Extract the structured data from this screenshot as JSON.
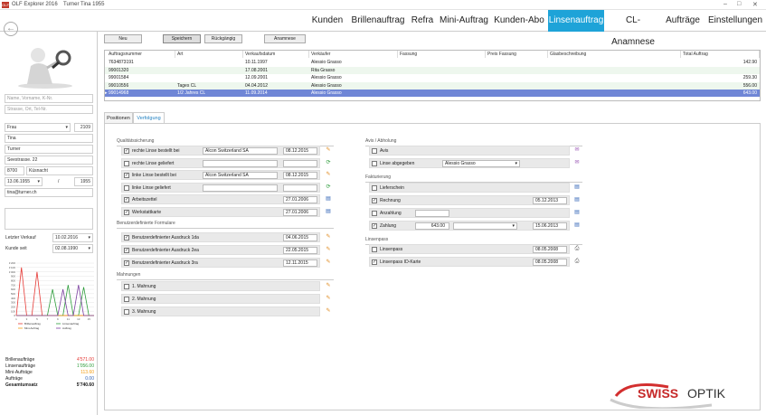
{
  "titlebar": {
    "app": "OLF Explorer 2016",
    "customer": "Turner  Tina  1955"
  },
  "nav": {
    "tabs": [
      "Kunden",
      "Brillenauftrag",
      "Refra",
      "Mini-Auftrag",
      "Kunden-Abo",
      "Linsenauftrag",
      "CL-Anamnese",
      "Aufträge",
      "Einstellungen"
    ]
  },
  "customer": {
    "search_name": "Name, Vorname, K-Nr.",
    "search_address": "Strasse, Ort, Tel-Nr.",
    "salutation": "Frau",
    "number": "2109",
    "firstname": "Tina",
    "lastname": "Turner",
    "street": "Seestrasse. 22",
    "zip": "8700",
    "city": "Küsnacht",
    "dob": "13.06.1955",
    "age_sep": "/",
    "year": "1955",
    "email": "tina@turner.ch",
    "last_sale_label": "Letzter Verkauf",
    "last_sale": "10.02.2016",
    "customer_since_label": "Kunde seit",
    "customer_since": "02.08.1990"
  },
  "chart_data": {
    "type": "line",
    "x": [
      1,
      2,
      3,
      4,
      5,
      6,
      7,
      8,
      9,
      10,
      11,
      12,
      13,
      14,
      15,
      16
    ],
    "xticks": [
      "1",
      "3",
      "5",
      "7",
      "9",
      "11",
      "13",
      "15"
    ],
    "yticks": [
      "1'200",
      "1'100",
      "1'000",
      "900",
      "800",
      "700",
      "600",
      "500",
      "400",
      "300",
      "200",
      "100",
      "0"
    ],
    "ylim": [
      0,
      1200
    ],
    "series": [
      {
        "name": "Brillenauftrag",
        "color": "#e53935",
        "values": [
          0,
          1100,
          0,
          0,
          1000,
          0,
          0,
          0,
          0,
          0,
          0,
          0,
          0,
          0,
          0,
          0
        ]
      },
      {
        "name": "Linsenauftrag",
        "color": "#2e9d3c",
        "values": [
          0,
          0,
          0,
          0,
          0,
          0,
          0,
          600,
          0,
          0,
          700,
          0,
          0,
          650,
          0,
          0
        ]
      },
      {
        "name": "Mini-Auftrag",
        "color": "#f39c12",
        "values": [
          0,
          0,
          0,
          0,
          0,
          0,
          0,
          0,
          0,
          0,
          0,
          0,
          0,
          0,
          0,
          0
        ]
      },
      {
        "name": "Auftrag",
        "color": "#7b3fa0",
        "values": [
          0,
          0,
          0,
          0,
          0,
          0,
          0,
          0,
          0,
          600,
          0,
          0,
          700,
          0,
          0,
          0
        ]
      }
    ]
  },
  "stats": [
    {
      "label": "Brillenaufträge",
      "value": "4'571.00",
      "color": "#e53935"
    },
    {
      "label": "Linsenaufträge",
      "value": "1'056.00",
      "color": "#2e9d3c"
    },
    {
      "label": "Mini-Aufträge",
      "value": "113.60",
      "color": "#f39c12"
    },
    {
      "label": "Aufträge",
      "value": "0.00",
      "color": "#2b5fb4"
    },
    {
      "label": "Gesamtumsatz",
      "value": "5'740.60",
      "color": "#111"
    }
  ],
  "toolbar": {
    "new": "Neu",
    "save": "Speichern",
    "undo": "Rückgängig",
    "anamnesis": "Anamnese"
  },
  "grid": {
    "headers": [
      "Auftragsnummer",
      "Art",
      "Verkaufsdatum",
      "Verkäufer",
      "Fassung",
      "Preis Fassung",
      "Glasbeschreibung",
      "Total Auftrag"
    ],
    "rows": [
      [
        "7634873191",
        "",
        "10.11.1997",
        "Alessio Grasso",
        "",
        "",
        "",
        "142.90"
      ],
      [
        "99001320",
        "",
        "17.08.2001",
        "Rita Grasso",
        "",
        "",
        "",
        ""
      ],
      [
        "99001584",
        "",
        "12.09.2001",
        "Alessio Grasso",
        "",
        "",
        "",
        "259.30"
      ],
      [
        "99010556",
        "Tages CL",
        "04.04.2012",
        "Alessio Grasso",
        "",
        "",
        "",
        "556.00"
      ],
      [
        "99014968",
        "1/2 Jahres CL",
        "11.09.2014",
        "Alessio Grasso",
        "",
        "",
        "",
        "643.00"
      ]
    ]
  },
  "subtabs": [
    "Positionen",
    "Verfolgung"
  ],
  "qs": {
    "title": "Qualitätssicherung",
    "rows": [
      {
        "label": "rechte Linse bestellt bei",
        "checked": true,
        "text": "Alcon Switzerland SA",
        "date": "08.12.2015"
      },
      {
        "label": "rechte Linse geliefert",
        "checked": false,
        "text": "",
        "date": ""
      },
      {
        "label": "linke Linse bestellt bei",
        "checked": true,
        "text": "Alcon Switzerland SA",
        "date": "08.12.2015"
      },
      {
        "label": "linke Linse geliefert",
        "checked": false,
        "text": "",
        "date": ""
      },
      {
        "label": "Arbeitszettel",
        "checked": true,
        "text": "",
        "date": "27.01.2006"
      },
      {
        "label": "Werkstattkarte",
        "checked": true,
        "text": "",
        "date": "27.01.2006"
      }
    ]
  },
  "forms": {
    "title": "Benutzerdefinierte Formulare",
    "rows": [
      {
        "label": "Benutzerdefinierter Ausdruck 1da",
        "date": "04.06.2015"
      },
      {
        "label": "Benutzerdefinierter Ausdruck 2ea",
        "date": "22.05.2015"
      },
      {
        "label": "Benutzerdefinierter Ausdruck 3ra",
        "date": "12.11.2015"
      }
    ]
  },
  "reminders": {
    "title": "Mahnungen",
    "rows": [
      "1. Mahnung",
      "2. Mahnung",
      "3. Mahnung"
    ]
  },
  "avis": {
    "title": "Avis / Abholung",
    "rows": [
      {
        "label": "Avis",
        "checked": false,
        "value": ""
      },
      {
        "label": "Linse abgegeben",
        "checked": false,
        "value": "Alessio Grasso"
      }
    ]
  },
  "billing": {
    "title": "Fakturierung",
    "rows": [
      {
        "label": "Lieferschein",
        "checked": false,
        "date": ""
      },
      {
        "label": "Rechnung",
        "checked": true,
        "date": "05.12.2013"
      },
      {
        "label": "Anzahlung",
        "checked": false,
        "date": ""
      },
      {
        "label": "Zahlung",
        "checked": true,
        "amount": "643.00",
        "date": "15.06.2013"
      }
    ]
  },
  "lenspass": {
    "title": "Linsenpass",
    "rows": [
      {
        "label": "Linsenpass",
        "checked": false,
        "date": "08.05.2008"
      },
      {
        "label": "Linsenpass ID-Karte",
        "checked": true,
        "date": "08.05.2008"
      }
    ]
  },
  "brand": {
    "name_a": "SWISS",
    "name_b": "OPTIK"
  }
}
